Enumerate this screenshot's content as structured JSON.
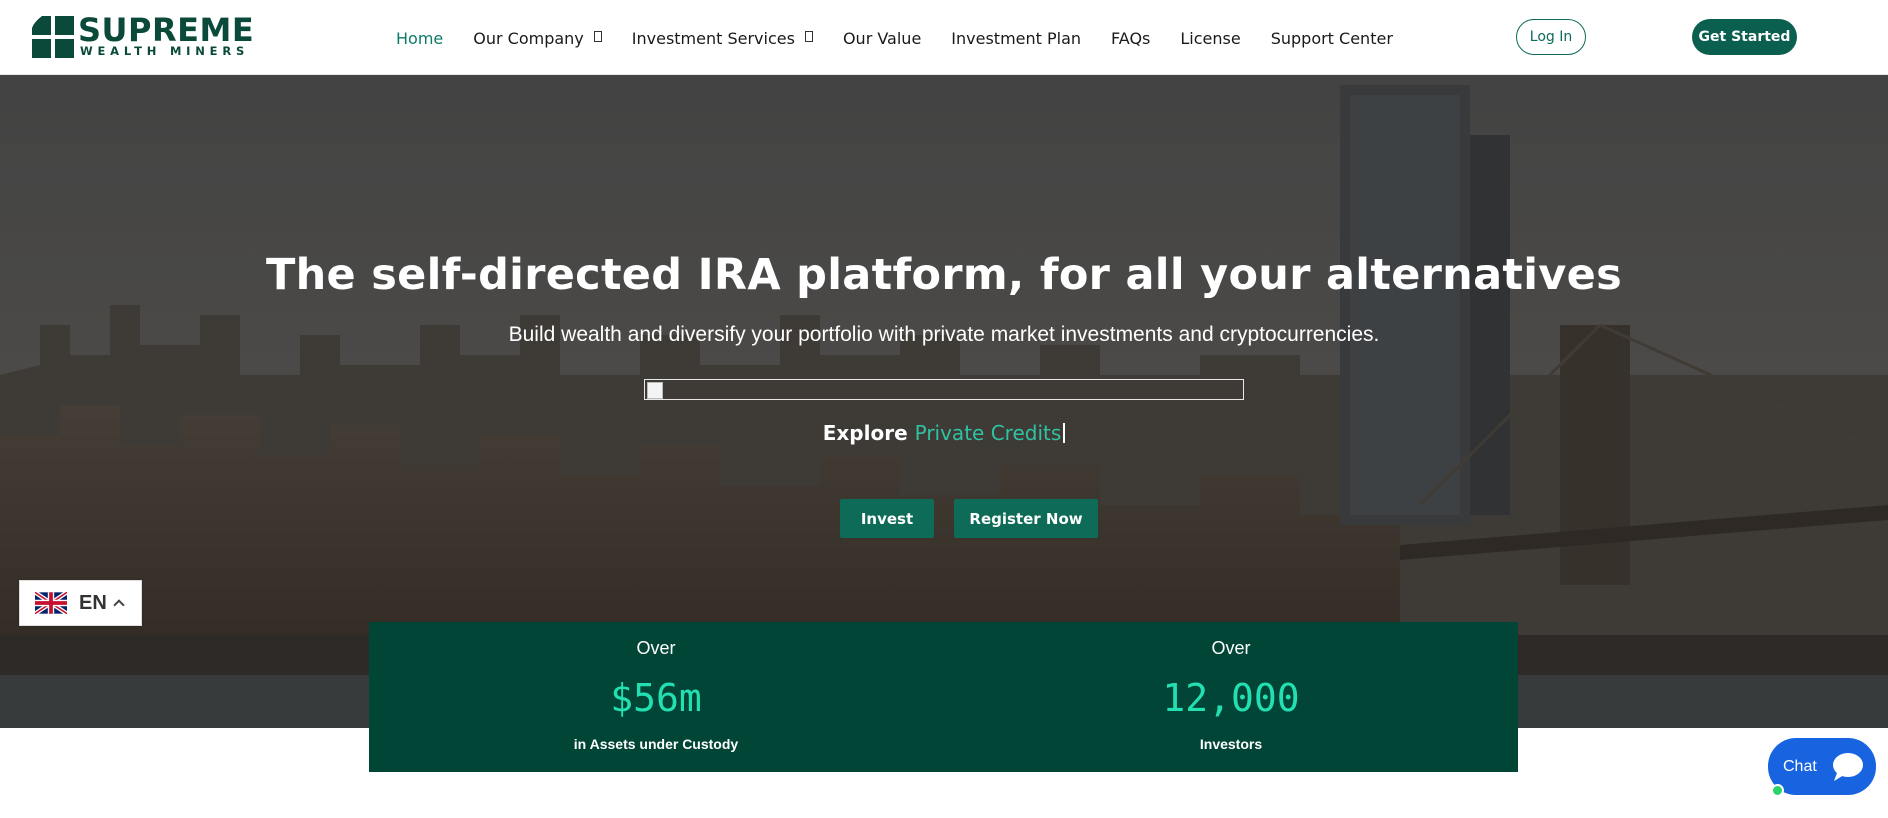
{
  "brand": {
    "name_top": "SUPREME",
    "name_bottom": "WEALTH MINERS",
    "colors": {
      "primary": "#0b4a3a",
      "accent": "#2fc2a2",
      "stat_value": "#22e0b1",
      "chat": "#1763e0"
    }
  },
  "nav": {
    "items": [
      {
        "label": "Home",
        "active": true,
        "dropdown": false
      },
      {
        "label": "Our Company",
        "active": false,
        "dropdown": true
      },
      {
        "label": "Investment Services",
        "active": false,
        "dropdown": true
      },
      {
        "label": "Our Value",
        "active": false,
        "dropdown": false
      },
      {
        "label": "Investment Plan",
        "active": false,
        "dropdown": false
      },
      {
        "label": "FAQs",
        "active": false,
        "dropdown": false
      },
      {
        "label": "License",
        "active": false,
        "dropdown": false
      },
      {
        "label": "Support Center",
        "active": false,
        "dropdown": false
      }
    ],
    "login_label": "Log In",
    "cta_label": "Get Started"
  },
  "hero": {
    "title": "The self-directed IRA platform, for all your alternatives",
    "subtitle": "Build wealth and diversify your portfolio with private market investments and cryptocurrencies.",
    "explore_prefix": "Explore",
    "explore_highlight": "Private Credits",
    "invest_label": "Invest",
    "register_label": "Register Now"
  },
  "language": {
    "code": "EN",
    "icon": "uk-flag-icon"
  },
  "stats": [
    {
      "over": "Over",
      "value": "$56m",
      "caption": "in Assets under Custody"
    },
    {
      "over": "Over",
      "value": "12,000",
      "caption": "Investors"
    }
  ],
  "chat": {
    "label": "Chat",
    "icon": "chat-bubble-icon"
  }
}
